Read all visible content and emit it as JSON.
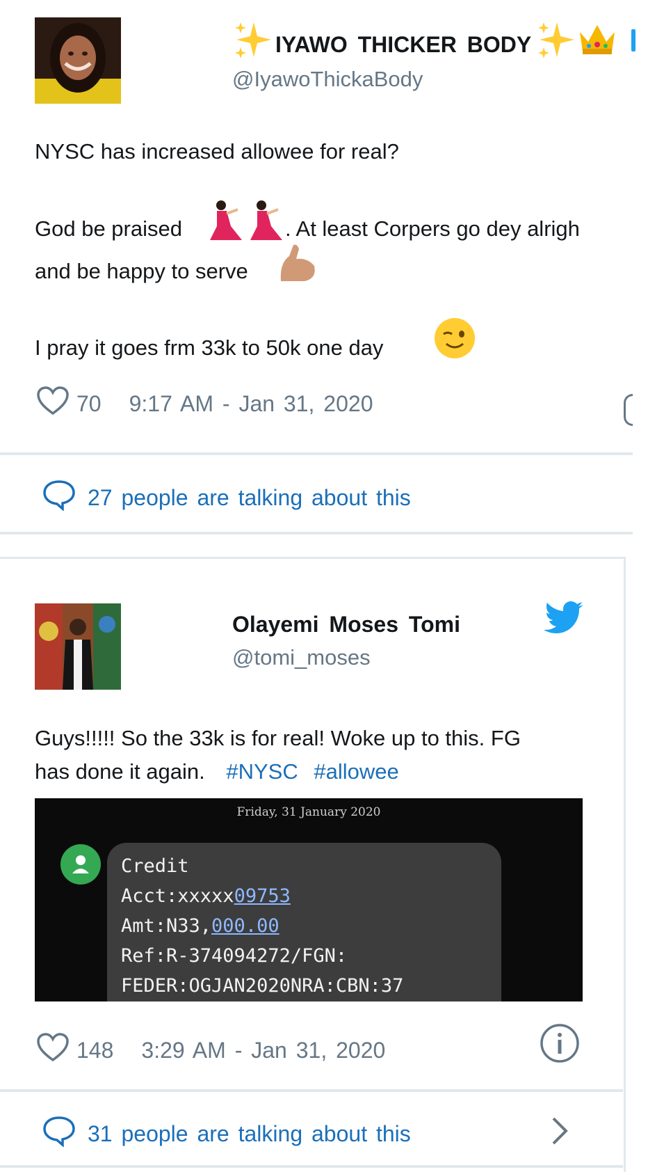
{
  "tweets": [
    {
      "name": "IYAWO THICKER BODY",
      "handle": "@IyawoThickaBody",
      "lines": [
        "NYSC has increased allowee for real?",
        "God be praised",
        ".  At least Corpers go dey alrigh",
        "and be happy to serve",
        "I pray it goes frm 33k to 50k one day"
      ],
      "likes": "70",
      "time": "9:17 AM - Jan 31, 2020",
      "talking": "27 people are talking about this"
    },
    {
      "name": "Olayemi Moses Tomi",
      "handle": "@tomi_moses",
      "lines": [
        "Guys!!!!! So the 33k is for real! Woke up to this. FG",
        "has done it again."
      ],
      "hashtags": [
        "#NYSC",
        "#allowee"
      ],
      "sms": {
        "date": "Friday, 31 January 2020",
        "line1": "Credit",
        "acct_prefix": "Acct:xxxxx",
        "acct_link": "09753",
        "amt_prefix": "Amt:N33,",
        "amt_link": "000.00",
        "ref": "Ref:R-374094272/FGN:",
        "feder": "FEDER:OGJAN2020NRA:CBN:37"
      },
      "likes": "148",
      "time": "3:29 AM - Jan 31, 2020",
      "talking": "31 people are talking about this"
    }
  ],
  "icons": {
    "heart": "heart-icon",
    "bubble": "speech-bubble-icon",
    "info": "info-icon",
    "chevron": "chevron-right-icon",
    "twitter": "twitter-bird-icon"
  },
  "colors": {
    "link": "#1b6fb8",
    "muted": "#657786",
    "twitter": "#1da1f2"
  }
}
